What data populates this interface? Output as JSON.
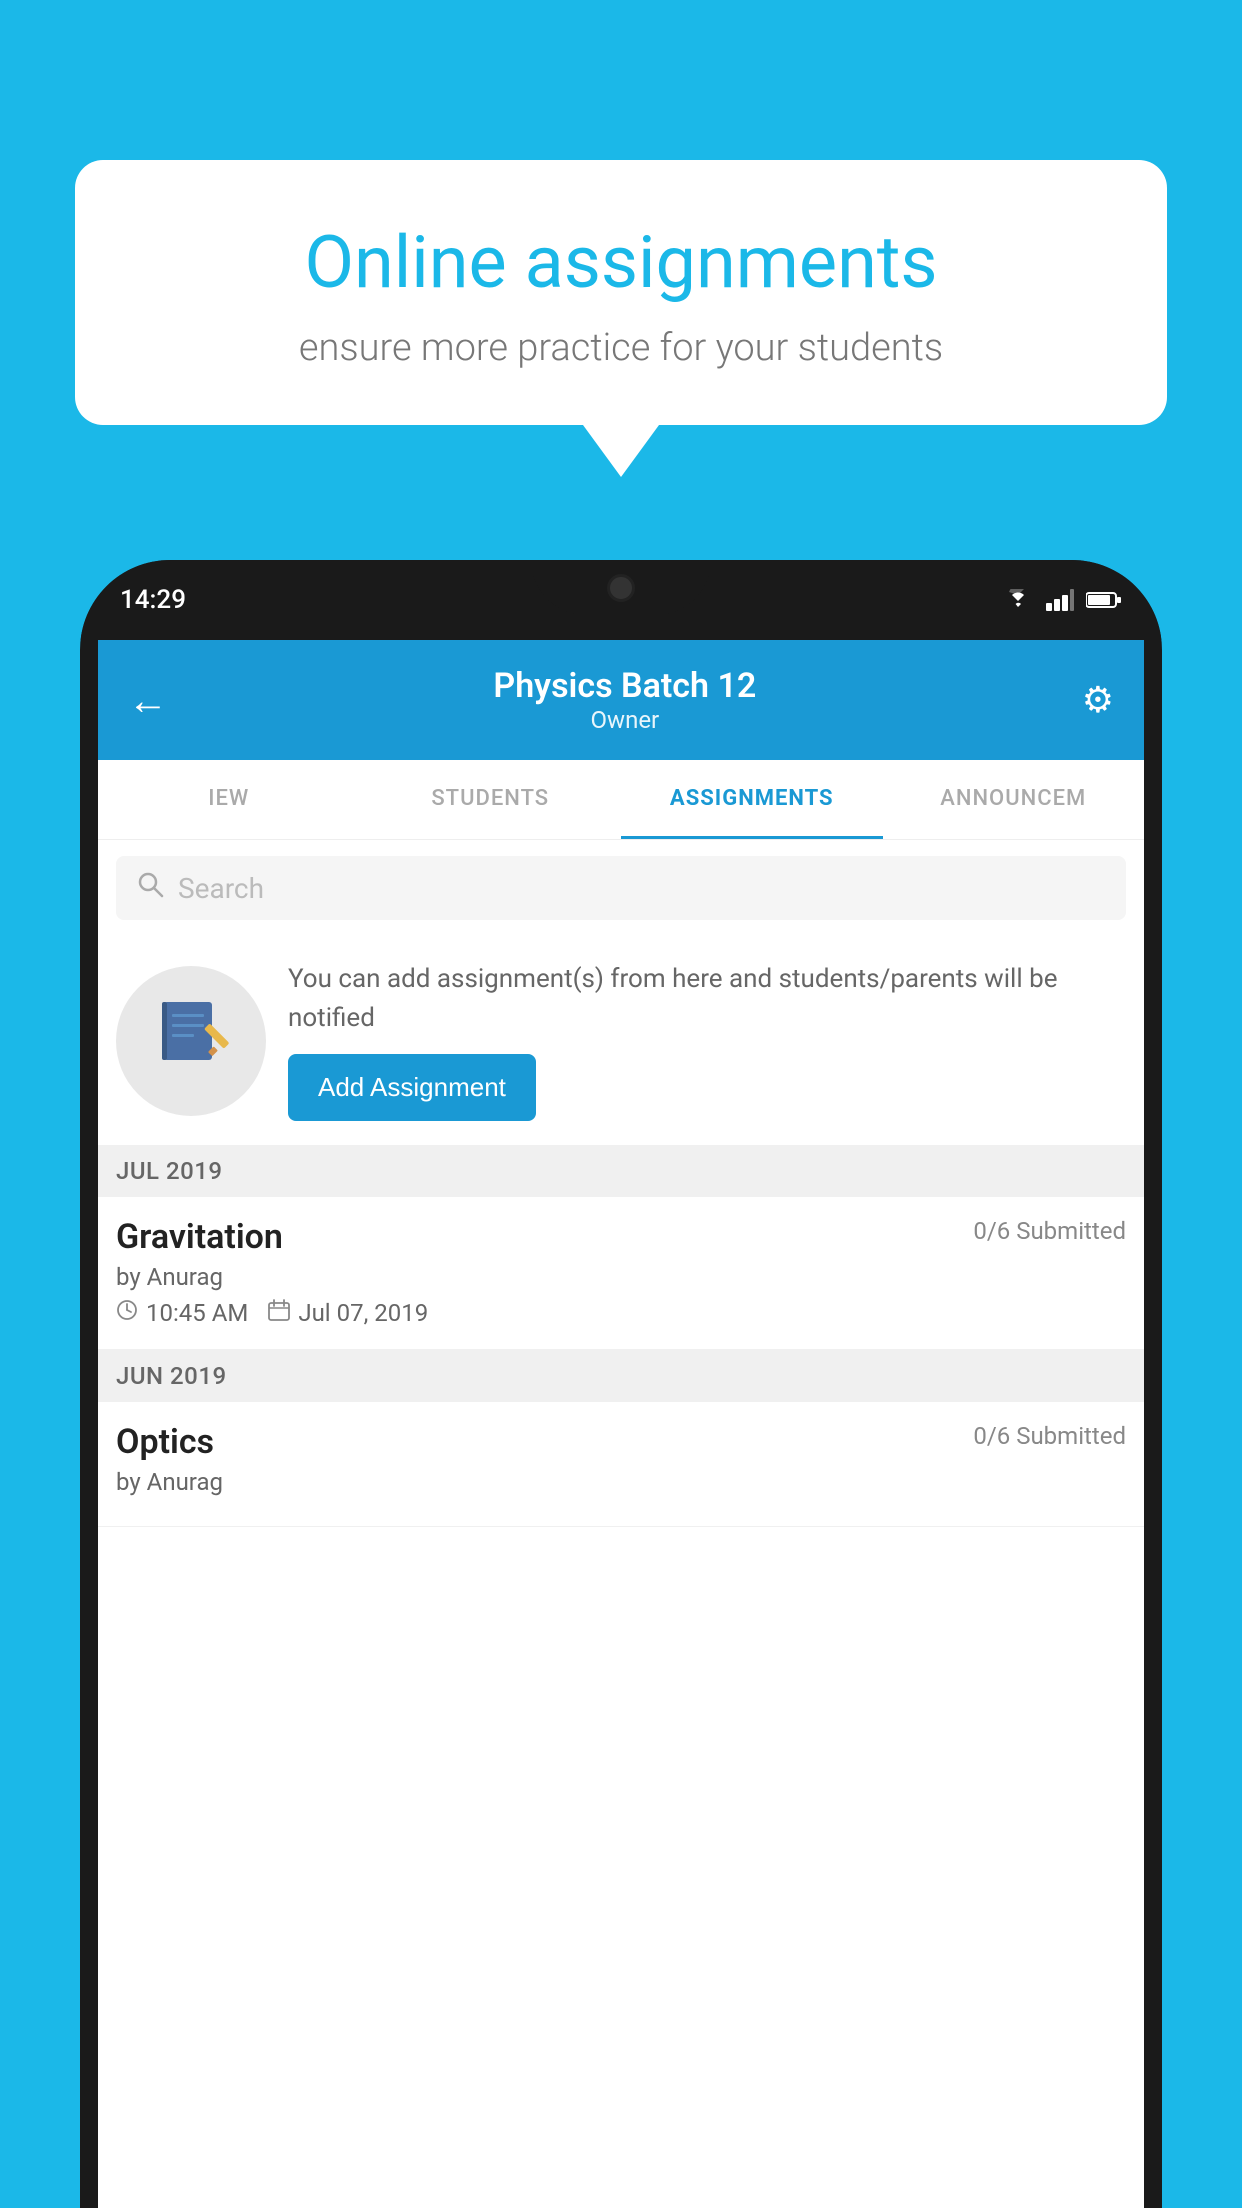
{
  "background": {
    "color": "#1bb8e8"
  },
  "speech_bubble": {
    "title": "Online assignments",
    "subtitle": "ensure more practice for your students"
  },
  "phone": {
    "status_bar": {
      "time": "14:29",
      "wifi_icon": "▼",
      "signal_icon": "▲",
      "battery_icon": "▪"
    },
    "header": {
      "title": "Physics Batch 12",
      "subtitle": "Owner",
      "back_icon": "←",
      "gear_icon": "⚙"
    },
    "tabs": [
      {
        "label": "IEW",
        "active": false
      },
      {
        "label": "STUDENTS",
        "active": false
      },
      {
        "label": "ASSIGNMENTS",
        "active": true
      },
      {
        "label": "ANNOUNCEM",
        "active": false
      }
    ],
    "search": {
      "placeholder": "Search"
    },
    "promo": {
      "text": "You can add assignment(s) from here and students/parents will be notified",
      "button_label": "Add Assignment"
    },
    "sections": [
      {
        "label": "JUL 2019",
        "assignments": [
          {
            "title": "Gravitation",
            "submitted": "0/6 Submitted",
            "author": "by Anurag",
            "time": "10:45 AM",
            "date": "Jul 07, 2019"
          }
        ]
      },
      {
        "label": "JUN 2019",
        "assignments": [
          {
            "title": "Optics",
            "submitted": "0/6 Submitted",
            "author": "by Anurag",
            "time": "",
            "date": ""
          }
        ]
      }
    ]
  }
}
